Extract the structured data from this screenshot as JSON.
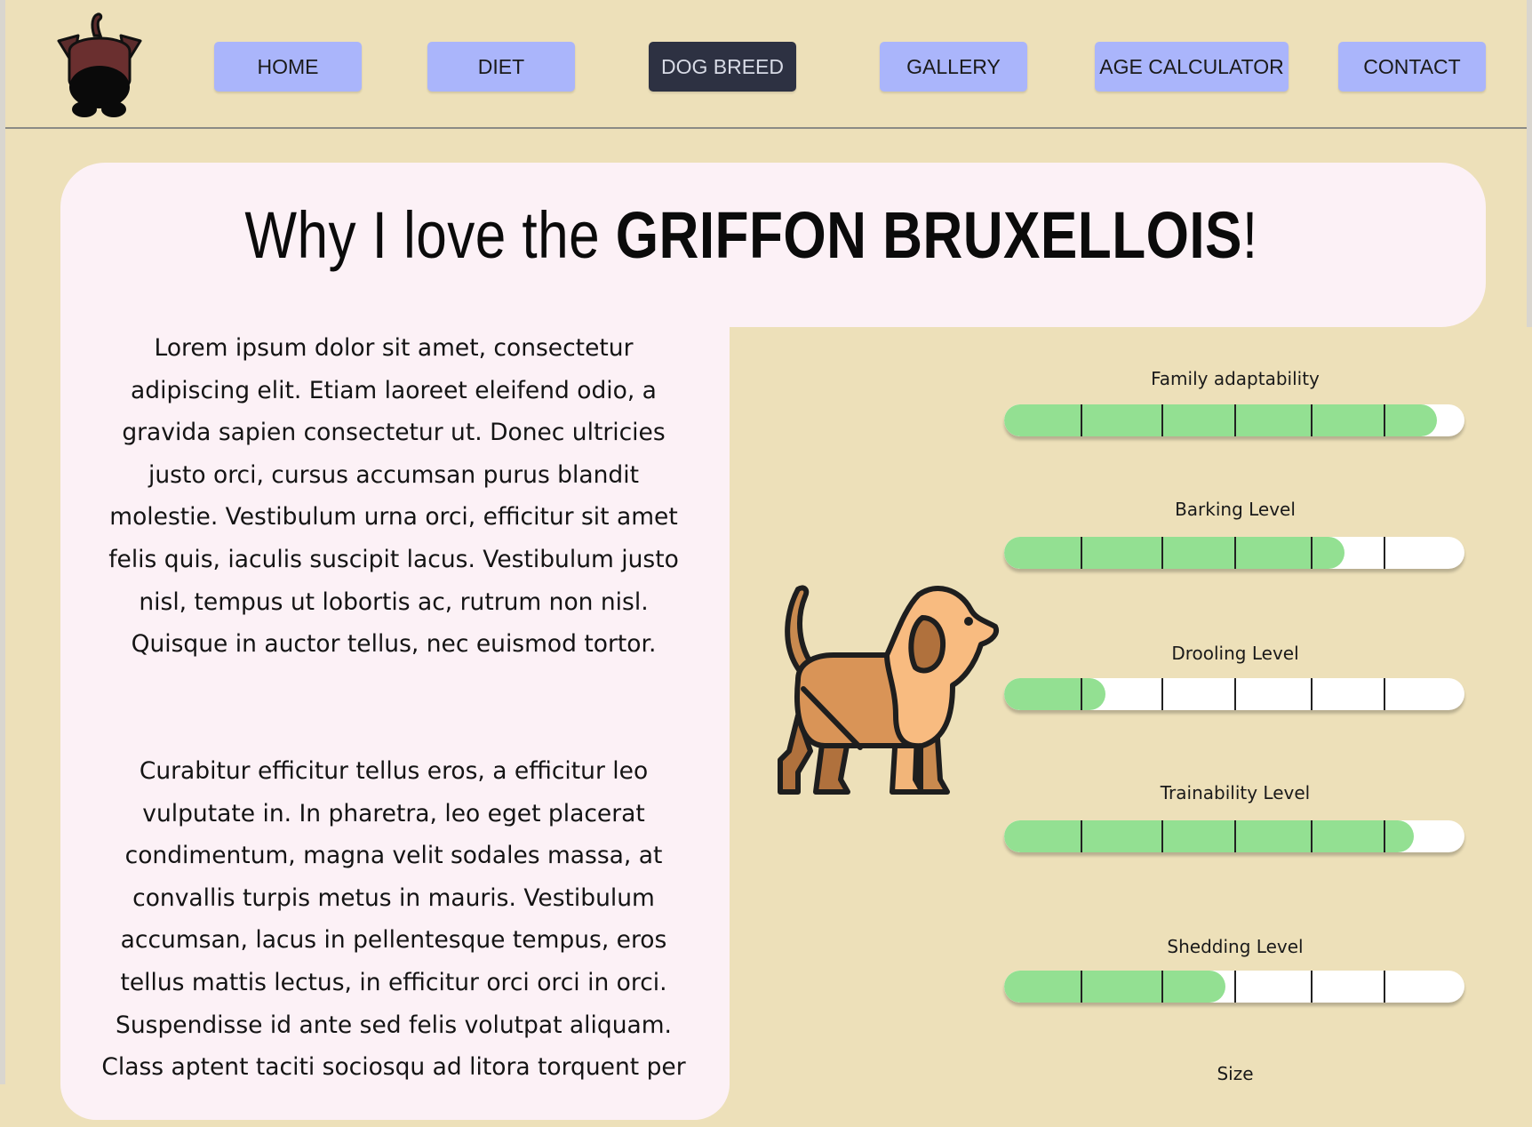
{
  "nav": {
    "items": [
      {
        "label": "HOME",
        "active": false
      },
      {
        "label": "DIET",
        "active": false
      },
      {
        "label": "DOG BREED",
        "active": true
      },
      {
        "label": "GALLERY",
        "active": false
      },
      {
        "label": "AGE CALCULATOR",
        "active": false
      },
      {
        "label": "CONTACT",
        "active": false
      }
    ]
  },
  "logo": {
    "icon": "dog-head-icon"
  },
  "title": {
    "prefix": "Why I love the ",
    "breed": "GRIFFON BRUXELLOIS",
    "suffix": "!"
  },
  "content": {
    "paragraph_1": "Lorem ipsum dolor sit amet, consectetur adipiscing elit. Etiam laoreet eleifend odio, a gravida sapien consectetur ut. Donec ultricies justo orci, cursus accumsan purus blandit molestie. Vestibulum urna orci, efficitur sit amet felis quis, iaculis suscipit lacus. Vestibulum justo nisl, tempus ut lobortis ac, rutrum non nisl. Quisque in auctor tellus, nec euismod tortor.",
    "paragraph_2": "Curabitur efficitur tellus eros, a efficitur leo vulputate in. In pharetra, leo eget placerat condimentum, magna velit sodales massa, at convallis turpis metus in mauris. Vestibulum accumsan, lacus in pellentesque tempus, eros tellus mattis lectus, in efficitur orci orci in orci. Suspendisse id ante sed felis volutpat aliquam. Class aptent taciti sociosqu ad litora torquent per"
  },
  "illustration": {
    "icon": "dog-illustration-icon"
  },
  "stats": [
    {
      "label": "Family adaptability",
      "fill_fraction": 0.94
    },
    {
      "label": "Barking Level",
      "fill_fraction": 0.74
    },
    {
      "label": "Drooling Level",
      "fill_fraction": 0.22
    },
    {
      "label": "Trainability Level",
      "fill_fraction": 0.89
    },
    {
      "label": "Shedding Level",
      "fill_fraction": 0.48
    },
    {
      "label": "Size",
      "fill_fraction": null
    }
  ],
  "colors": {
    "background": "#ede0b9",
    "nav_button": "#aab5fb",
    "nav_active": "#2d3142",
    "card": "#fcf1f6",
    "bar_fill": "#93e092",
    "bar_track": "#ffffff"
  }
}
